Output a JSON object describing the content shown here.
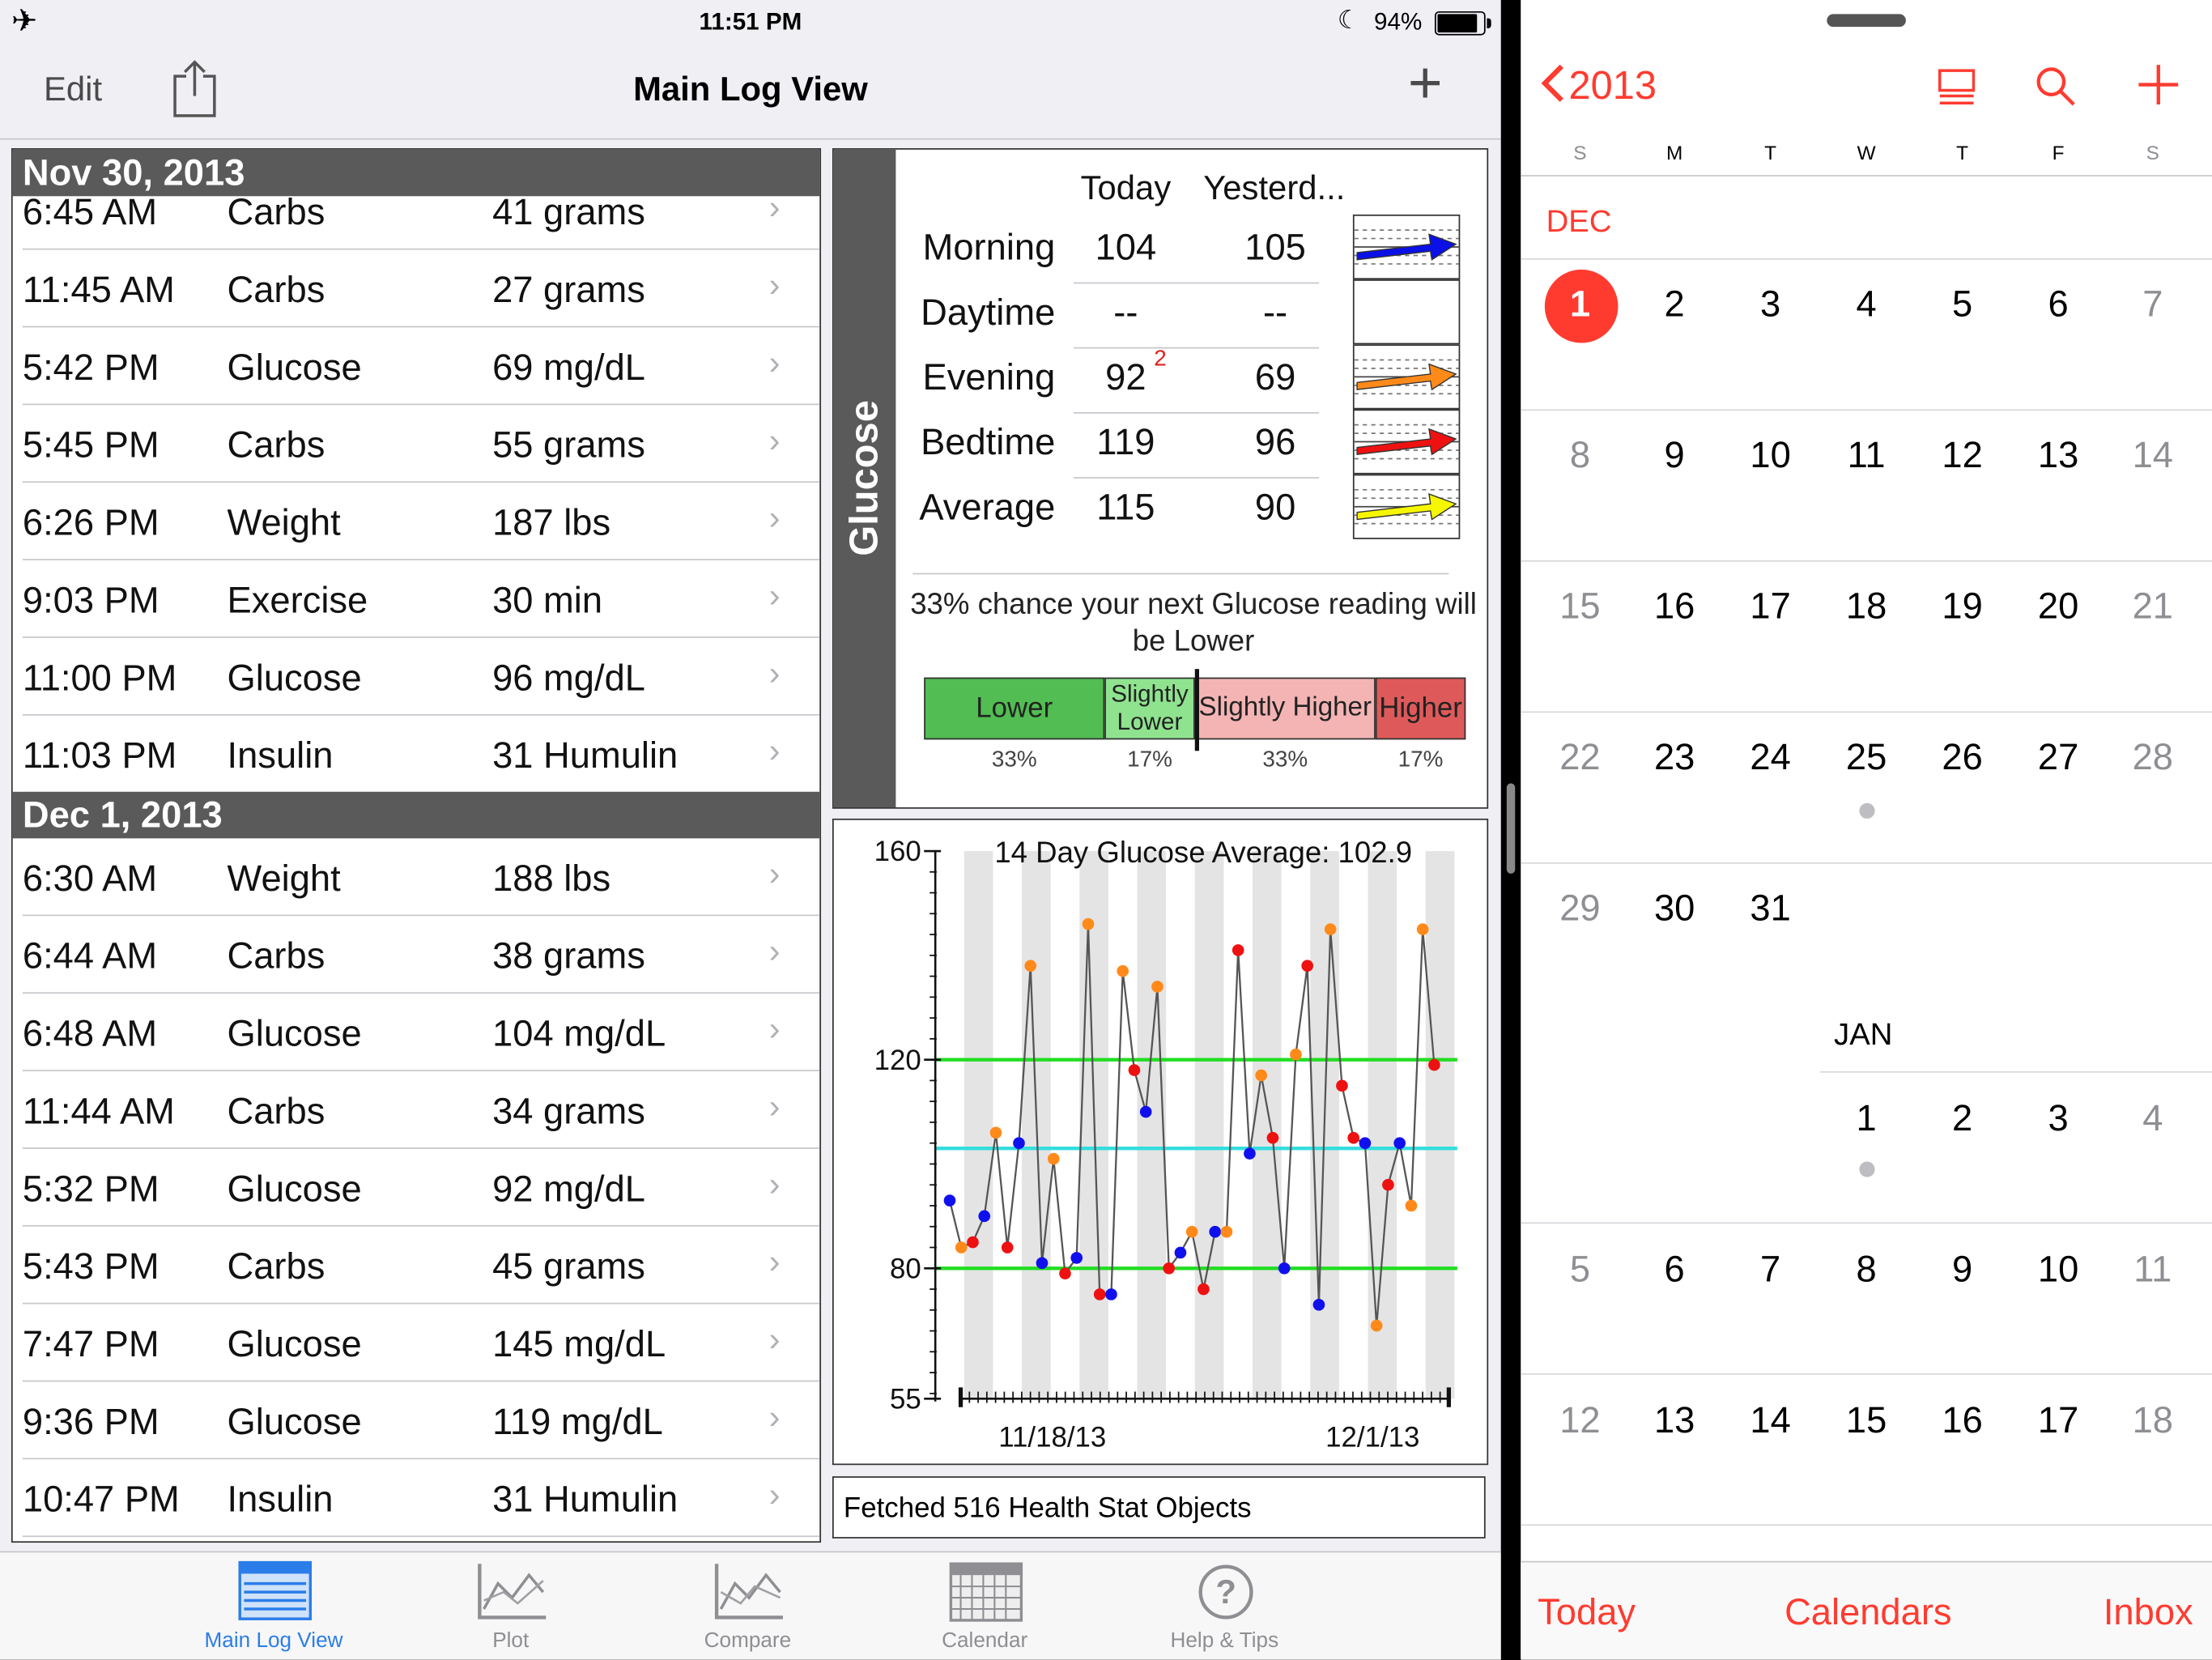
{
  "status": {
    "time": "11:51 PM",
    "battery": "94%",
    "battery_level": 0.94
  },
  "nav": {
    "edit": "Edit",
    "title": "Main Log View"
  },
  "log": [
    {
      "date": "Nov 30, 2013",
      "entries": [
        {
          "time": "6:45 AM",
          "type": "Carbs",
          "value": "41 grams"
        },
        {
          "time": "11:45 AM",
          "type": "Carbs",
          "value": "27 grams"
        },
        {
          "time": "5:42 PM",
          "type": "Glucose",
          "value": "69 mg/dL"
        },
        {
          "time": "5:45 PM",
          "type": "Carbs",
          "value": "55 grams"
        },
        {
          "time": "6:26 PM",
          "type": "Weight",
          "value": "187 lbs"
        },
        {
          "time": "9:03 PM",
          "type": "Exercise",
          "value": "30 min"
        },
        {
          "time": "11:00 PM",
          "type": "Glucose",
          "value": "96 mg/dL"
        },
        {
          "time": "11:03 PM",
          "type": "Insulin",
          "value": "31 Humulin"
        }
      ]
    },
    {
      "date": "Dec 1, 2013",
      "entries": [
        {
          "time": "6:30 AM",
          "type": "Weight",
          "value": "188 lbs"
        },
        {
          "time": "6:44 AM",
          "type": "Carbs",
          "value": "38 grams"
        },
        {
          "time": "6:48 AM",
          "type": "Glucose",
          "value": "104 mg/dL"
        },
        {
          "time": "11:44 AM",
          "type": "Carbs",
          "value": "34 grams"
        },
        {
          "time": "5:32 PM",
          "type": "Glucose",
          "value": "92 mg/dL"
        },
        {
          "time": "5:43 PM",
          "type": "Carbs",
          "value": "45 grams"
        },
        {
          "time": "7:47 PM",
          "type": "Glucose",
          "value": "145 mg/dL"
        },
        {
          "time": "9:36 PM",
          "type": "Glucose",
          "value": "119 mg/dL"
        },
        {
          "time": "10:47 PM",
          "type": "Insulin",
          "value": "31 Humulin"
        }
      ]
    }
  ],
  "glucose": {
    "label": "Glucose",
    "col_today": "Today",
    "col_yesterday": "Yesterd...",
    "rows": [
      {
        "period": "Morning",
        "today": "104",
        "yesterday": "105",
        "trend": "#0a10e6"
      },
      {
        "period": "Daytime",
        "today": "--",
        "yesterday": "--",
        "trend": ""
      },
      {
        "period": "Evening",
        "today": "92",
        "today_sup": "2",
        "yesterday": "69",
        "trend": "#ff8a1a"
      },
      {
        "period": "Bedtime",
        "today": "119",
        "yesterday": "96",
        "trend": "#ee1111"
      },
      {
        "period": "Average",
        "today": "115",
        "yesterday": "90",
        "trend": "#f6f600"
      }
    ],
    "prediction": "33% chance your next Glucose reading will be Lower",
    "buckets": [
      {
        "label": "Lower",
        "pct": "33%",
        "color": "#52bd52"
      },
      {
        "label": "Slightly Lower",
        "pct": "17%",
        "color": "#8fe38f"
      },
      {
        "label": "Slightly Higher",
        "pct": "33%",
        "color": "#f4b4b4"
      },
      {
        "label": "Higher",
        "pct": "17%",
        "color": "#de5a5a"
      }
    ]
  },
  "chart_data": {
    "type": "line",
    "title": "14 Day Glucose Average: 102.9",
    "ylim": [
      55,
      160
    ],
    "yticks": [
      55,
      80,
      120,
      160
    ],
    "xtick_labels": [
      "11/18/13",
      "12/1/13"
    ],
    "reference_lines": [
      {
        "y": 120,
        "color": "#22dd22"
      },
      {
        "y": 80,
        "color": "#22dd22"
      },
      {
        "y": 103,
        "color": "#33dddd"
      }
    ],
    "grid_bands": true,
    "points": [
      {
        "x": 0.5,
        "y": 93,
        "c": "#1010ee"
      },
      {
        "x": 0.9,
        "y": 84,
        "c": "#ff8a1a"
      },
      {
        "x": 1.3,
        "y": 85,
        "c": "#ee1111"
      },
      {
        "x": 1.7,
        "y": 90,
        "c": "#1010ee"
      },
      {
        "x": 2.1,
        "y": 106,
        "c": "#ff8a1a"
      },
      {
        "x": 2.5,
        "y": 84,
        "c": "#ee1111"
      },
      {
        "x": 2.9,
        "y": 104,
        "c": "#1010ee"
      },
      {
        "x": 3.3,
        "y": 138,
        "c": "#ff8a1a"
      },
      {
        "x": 3.7,
        "y": 81,
        "c": "#1010ee"
      },
      {
        "x": 4.1,
        "y": 101,
        "c": "#ff8a1a"
      },
      {
        "x": 4.5,
        "y": 79,
        "c": "#ee1111"
      },
      {
        "x": 4.9,
        "y": 82,
        "c": "#1010ee"
      },
      {
        "x": 5.3,
        "y": 146,
        "c": "#ff8a1a"
      },
      {
        "x": 5.7,
        "y": 75,
        "c": "#ee1111"
      },
      {
        "x": 6.1,
        "y": 75,
        "c": "#1010ee"
      },
      {
        "x": 6.5,
        "y": 137,
        "c": "#ff8a1a"
      },
      {
        "x": 6.9,
        "y": 118,
        "c": "#ee1111"
      },
      {
        "x": 7.3,
        "y": 110,
        "c": "#1010ee"
      },
      {
        "x": 7.7,
        "y": 134,
        "c": "#ff8a1a"
      },
      {
        "x": 8.1,
        "y": 80,
        "c": "#ee1111"
      },
      {
        "x": 8.5,
        "y": 83,
        "c": "#1010ee"
      },
      {
        "x": 8.9,
        "y": 87,
        "c": "#ff8a1a"
      },
      {
        "x": 9.3,
        "y": 76,
        "c": "#ee1111"
      },
      {
        "x": 9.7,
        "y": 87,
        "c": "#1010ee"
      },
      {
        "x": 10.1,
        "y": 87,
        "c": "#ff8a1a"
      },
      {
        "x": 10.5,
        "y": 141,
        "c": "#ee1111"
      },
      {
        "x": 10.9,
        "y": 102,
        "c": "#1010ee"
      },
      {
        "x": 11.3,
        "y": 117,
        "c": "#ff8a1a"
      },
      {
        "x": 11.7,
        "y": 105,
        "c": "#ee1111"
      },
      {
        "x": 12.1,
        "y": 80,
        "c": "#1010ee"
      },
      {
        "x": 12.5,
        "y": 121,
        "c": "#ff8a1a"
      },
      {
        "x": 12.9,
        "y": 138,
        "c": "#ee1111"
      },
      {
        "x": 13.3,
        "y": 73,
        "c": "#1010ee"
      },
      {
        "x": 13.7,
        "y": 145,
        "c": "#ff8a1a"
      },
      {
        "x": 14.1,
        "y": 115,
        "c": "#ee1111"
      },
      {
        "x": 14.5,
        "y": 105,
        "c": "#ee1111"
      },
      {
        "x": 14.9,
        "y": 104,
        "c": "#1010ee"
      },
      {
        "x": 15.3,
        "y": 69,
        "c": "#ff8a1a"
      },
      {
        "x": 15.7,
        "y": 96,
        "c": "#ee1111"
      },
      {
        "x": 16.1,
        "y": 104,
        "c": "#1010ee"
      },
      {
        "x": 16.5,
        "y": 92,
        "c": "#ff8a1a"
      },
      {
        "x": 16.9,
        "y": 145,
        "c": "#ff8a1a"
      },
      {
        "x": 17.3,
        "y": 119,
        "c": "#ee1111"
      }
    ]
  },
  "fetch_status": "Fetched 516 Health Stat Objects",
  "tabs": [
    {
      "label": "Main Log View",
      "icon": "list-icon",
      "active": true
    },
    {
      "label": "Plot",
      "icon": "line-chart-icon",
      "active": false
    },
    {
      "label": "Compare",
      "icon": "compare-chart-icon",
      "active": false
    },
    {
      "label": "Calendar",
      "icon": "calendar-grid-icon",
      "active": false
    },
    {
      "label": "Help & Tips",
      "icon": "help-icon",
      "active": false
    }
  ],
  "calendar": {
    "year": "2013",
    "weekdays": [
      "S",
      "M",
      "T",
      "W",
      "T",
      "F",
      "S"
    ],
    "dec_label": "DEC",
    "jan_label": "JAN",
    "dec_weeks": [
      [
        "1",
        "2",
        "3",
        "4",
        "5",
        "6",
        "7"
      ],
      [
        "8",
        "9",
        "10",
        "11",
        "12",
        "13",
        "14"
      ],
      [
        "15",
        "16",
        "17",
        "18",
        "19",
        "20",
        "21"
      ],
      [
        "22",
        "23",
        "24",
        "25",
        "26",
        "27",
        "28"
      ],
      [
        "29",
        "30",
        "31",
        "",
        "",
        "",
        ""
      ]
    ],
    "jan_weeks": [
      [
        "",
        "",
        "",
        "1",
        "2",
        "3",
        "4"
      ],
      [
        "5",
        "6",
        "7",
        "8",
        "9",
        "10",
        "11"
      ],
      [
        "12",
        "13",
        "14",
        "15",
        "16",
        "17",
        "18"
      ]
    ],
    "toolbar": {
      "today": "Today",
      "calendars": "Calendars",
      "inbox": "Inbox"
    },
    "accent": "#ff3b30"
  }
}
